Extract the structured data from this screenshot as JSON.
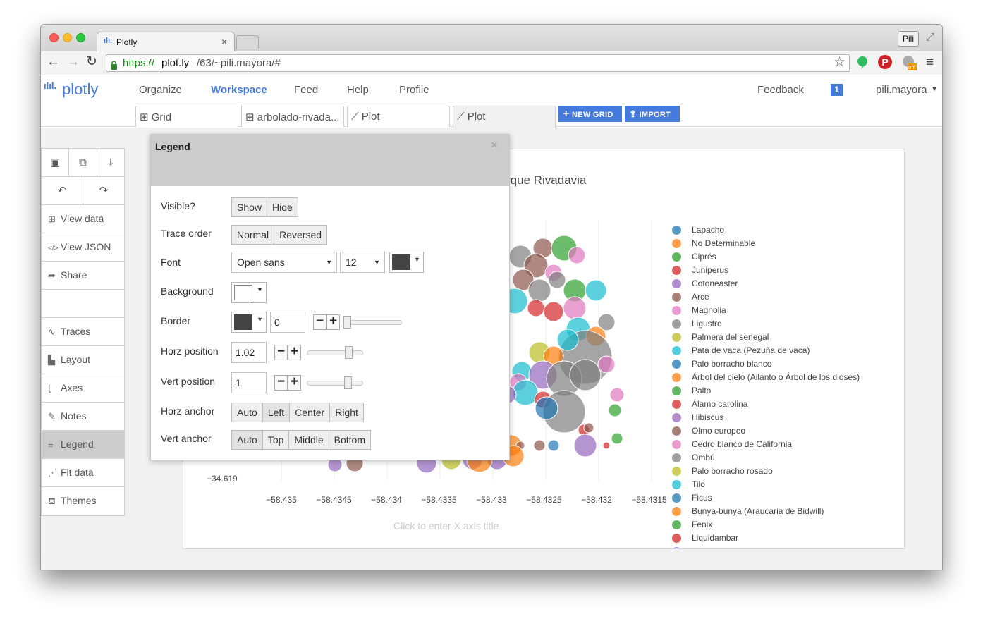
{
  "browser": {
    "tab_title": "Plotly",
    "tab_close": "×",
    "profile_button": "Pili",
    "url_scheme": "https://",
    "url_host": "plot.ly",
    "url_path": "/63/~pili.mayora/#"
  },
  "app": {
    "logo": "plotly",
    "nav": [
      "Organize",
      "Workspace",
      "Feed",
      "Help",
      "Profile"
    ],
    "feedback": "Feedback",
    "notif_count": "1",
    "user": "pili.mayora",
    "file_tabs": [
      "Grid",
      "arbolado-rivada...",
      "Plot",
      "Plot"
    ],
    "new_grid": "NEW GRID",
    "import": "IMPORT"
  },
  "sidebar": {
    "items": [
      "View data",
      "View JSON",
      "Share",
      "Traces",
      "Layout",
      "Axes",
      "Notes",
      "Legend",
      "Fit data",
      "Themes"
    ],
    "active": "Legend"
  },
  "legend_panel": {
    "title": "Legend",
    "close": "×",
    "visible": {
      "label": "Visible?",
      "options": [
        "Show",
        "Hide"
      ]
    },
    "trace_order": {
      "label": "Trace order",
      "options": [
        "Normal",
        "Reversed"
      ]
    },
    "font": {
      "label": "Font",
      "family": "Open sans",
      "size": "12",
      "color": "#444444"
    },
    "background": {
      "label": "Background",
      "color": "#ffffff"
    },
    "border": {
      "label": "Border",
      "color": "#444444",
      "width": "0"
    },
    "horz_position": {
      "label": "Horz position",
      "value": "1.02"
    },
    "vert_position": {
      "label": "Vert position",
      "value": "1"
    },
    "horz_anchor": {
      "label": "Horz anchor",
      "options": [
        "Auto",
        "Left",
        "Center",
        "Right"
      ],
      "selected": "Left"
    },
    "vert_anchor": {
      "label": "Vert anchor",
      "options": [
        "Auto",
        "Top",
        "Middle",
        "Bottom"
      ],
      "selected": "Auto"
    }
  },
  "plot": {
    "title_fragment": "rque Rivadavia",
    "xaxis_placeholder": "Click to enter X axis title",
    "y_tick": "−34.619",
    "x_ticks": [
      "−58.435",
      "−58.4345",
      "−58.434",
      "−58.4335",
      "−58.433",
      "−58.4325",
      "−58.432",
      "−58.4315"
    ]
  },
  "chart_data": {
    "type": "scatter",
    "title": "rque Rivadavia",
    "xlabel": "",
    "ylabel": "",
    "x_tick_labels": [
      "−58.435",
      "−58.4345",
      "−58.434",
      "−58.4335",
      "−58.433",
      "−58.4325",
      "−58.432",
      "−58.4315"
    ],
    "y_tick_labels": [
      "−34.619"
    ],
    "series": [
      {
        "name": "Lapacho",
        "color": "#1f77b4"
      },
      {
        "name": "No Determinable",
        "color": "#ff7f0e"
      },
      {
        "name": "Ciprés",
        "color": "#2ca02c"
      },
      {
        "name": "Juniperus",
        "color": "#d62728"
      },
      {
        "name": "Cotoneaster",
        "color": "#9467bd"
      },
      {
        "name": "Arce",
        "color": "#8c564b"
      },
      {
        "name": "Magnolia",
        "color": "#e377c2"
      },
      {
        "name": "Ligustro",
        "color": "#7f7f7f"
      },
      {
        "name": "Palmera del senegal",
        "color": "#bcbd22"
      },
      {
        "name": "Pata de vaca  (Pezuña de vaca)",
        "color": "#17becf"
      },
      {
        "name": "Palo borracho blanco",
        "color": "#1f77b4"
      },
      {
        "name": "Árbol del cielo (Ailanto o Árbol de los dioses)",
        "color": "#ff7f0e"
      },
      {
        "name": "Palto",
        "color": "#2ca02c"
      },
      {
        "name": "Álamo carolina",
        "color": "#d62728"
      },
      {
        "name": "Hibiscus",
        "color": "#9467bd"
      },
      {
        "name": "Olmo europeo",
        "color": "#8c564b"
      },
      {
        "name": "Cedro blanco de California",
        "color": "#e377c2"
      },
      {
        "name": "Ombú",
        "color": "#7f7f7f"
      },
      {
        "name": "Palo borracho rosado",
        "color": "#bcbd22"
      },
      {
        "name": "Tilo",
        "color": "#17becf"
      },
      {
        "name": "Ficus",
        "color": "#1f77b4"
      },
      {
        "name": "Bunya-bunya (Araucaria de Bidwill)",
        "color": "#ff7f0e"
      },
      {
        "name": "Fenix",
        "color": "#2ca02c"
      },
      {
        "name": "Liquidambar",
        "color": "#d62728"
      },
      {
        "name": "",
        "color": "#9467bd"
      }
    ]
  }
}
